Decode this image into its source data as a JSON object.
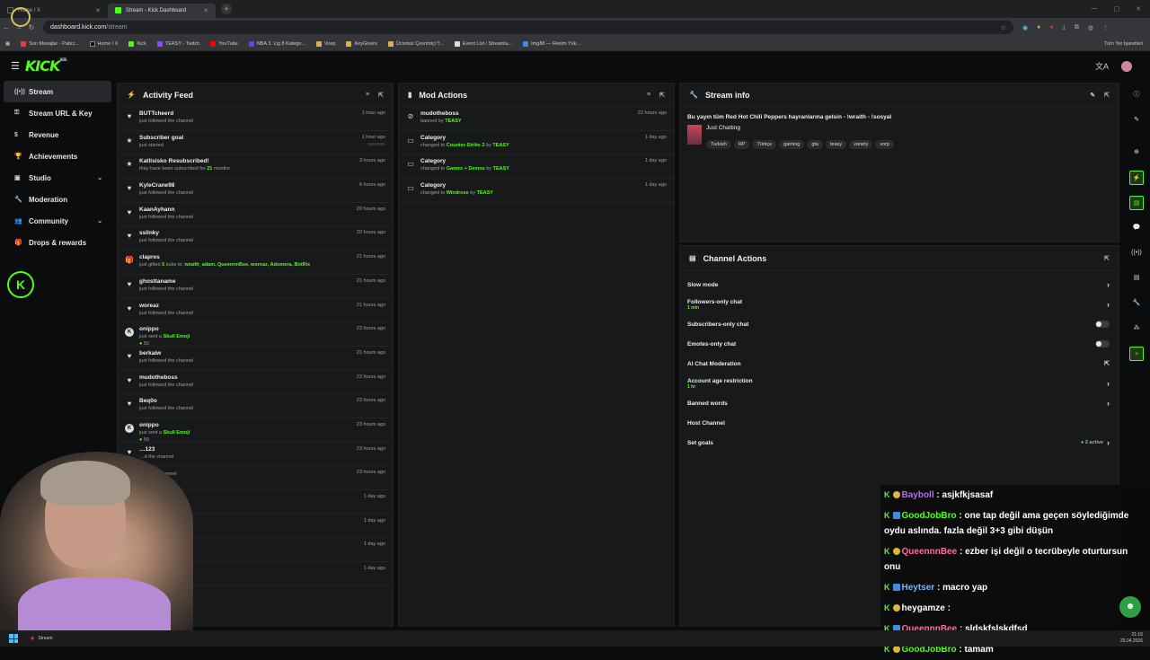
{
  "browser": {
    "tabs": [
      {
        "label": "Home / X",
        "active": false
      },
      {
        "label": "Stream - Kick Dashboard",
        "active": true
      }
    ],
    "url_host": "dashboard.kick.com",
    "url_path": "/stream",
    "bookmarks": [
      "Son Mesajlar - Pabci...",
      "Home / X",
      "Kick",
      "TEASY - Twitch",
      "YouTube",
      "NBA 3. Lig 8 Katego...",
      "Voep",
      "KeyGivers",
      "Ücretsiz Çevrimiçi Y...",
      "Event List / Streamla...",
      "Img88 — Resim Yük..."
    ],
    "bookmarks_right": "Tüm Yer İşaretleri"
  },
  "header": {
    "logo": "KICK",
    "logo_sup": "BETA"
  },
  "sidebar": {
    "items": [
      {
        "label": "Stream",
        "icon": "broadcast-icon",
        "active": true
      },
      {
        "label": "Stream URL & Key",
        "icon": "key-icon"
      },
      {
        "label": "Revenue",
        "icon": "dollar-icon"
      },
      {
        "label": "Achievements",
        "icon": "trophy-icon"
      },
      {
        "label": "Studio",
        "icon": "studio-icon",
        "expandable": true
      },
      {
        "label": "Moderation",
        "icon": "wrench-icon"
      },
      {
        "label": "Community",
        "icon": "people-icon",
        "expandable": true
      },
      {
        "label": "Drops & rewards",
        "icon": "gift-icon"
      }
    ]
  },
  "activity": {
    "title": "Activity Feed",
    "items": [
      {
        "name": "BUTTcheerd",
        "sub": "just followed the channel",
        "time": "1 hour ago",
        "icon": "heart"
      },
      {
        "name": "Subscriber goal",
        "sub": "just started",
        "time": "1 hour ago",
        "icon": "star"
      },
      {
        "name": "Katlisisko Resubscribed!",
        "sub": "they have been subscribed for ",
        "sub_green": "21",
        "sub_after": " months",
        "time": "3 hours ago",
        "icon": "star"
      },
      {
        "name": "KyleCrane98",
        "sub": "just followed the channel",
        "time": "6 hours ago",
        "icon": "heart"
      },
      {
        "name": "KaanAyhann",
        "sub": "just followed the channel",
        "time": "20 hours ago",
        "icon": "heart"
      },
      {
        "name": "sslinky",
        "sub": "just followed the channel",
        "time": "20 hours ago",
        "icon": "heart"
      },
      {
        "name": "clapres",
        "sub": "just gifted ",
        "sub_green": "5",
        "sub_after": " subs to: ",
        "sub_list": "wraith_adam, QueennnBee, woreaz, Adomera, BotRix",
        "time": "21 hours ago",
        "icon": "gift"
      },
      {
        "name": "ghosttaname",
        "sub": "just followed the channel",
        "time": "21 hours ago",
        "icon": "heart"
      },
      {
        "name": "woreaz",
        "sub": "just followed the channel",
        "time": "21 hours ago",
        "icon": "heart"
      },
      {
        "name": "onippo",
        "sub": "just sent a ",
        "sub_green": "Skull Emoji",
        "amount": "50",
        "time": "22 hours ago",
        "icon": "kick"
      },
      {
        "name": "berkaiw",
        "sub": "just followed the channel",
        "time": "21 hours ago",
        "icon": "heart"
      },
      {
        "name": "mudotheboss",
        "sub": "just followed the channel",
        "time": "22 hours ago",
        "icon": "heart"
      },
      {
        "name": "Beq0o",
        "sub": "just followed the channel",
        "time": "22 hours ago",
        "icon": "heart"
      },
      {
        "name": "onippo",
        "sub": "just sent a ",
        "sub_green": "Skull Emoji",
        "amount": "50",
        "time": "23 hours ago",
        "icon": "kick"
      },
      {
        "name": "…123",
        "sub": "…d the channel",
        "time": "23 hours ago",
        "icon": "heart"
      },
      {
        "name": "",
        "sub": "…ed the channel",
        "time": "23 hours ago",
        "icon": "heart"
      },
      {
        "name": "",
        "sub": "",
        "time": "1 day ago",
        "icon": "heart"
      },
      {
        "name": "",
        "sub": "",
        "time": "1 day ago",
        "icon": "heart"
      },
      {
        "name": "",
        "sub": "…oji",
        "time": "1 day ago",
        "icon": "kick"
      },
      {
        "name": "…06",
        "sub": "…he channel",
        "time": "1 day ago",
        "icon": "heart"
      }
    ]
  },
  "mod": {
    "title": "Mod Actions",
    "items": [
      {
        "name": "mudotheboss",
        "sub": "banned by ",
        "by": "TEASY",
        "time": "22 hours ago",
        "icon": "ban"
      },
      {
        "name": "Category",
        "sub": "changed to ",
        "cat": "Counter-Strike 2",
        "by": "TEASY",
        "time": "1 day ago",
        "icon": "cat"
      },
      {
        "name": "Category",
        "sub": "changed to ",
        "cat": "Games + Demos",
        "by": "TEASY",
        "time": "1 day ago",
        "icon": "cat"
      },
      {
        "name": "Category",
        "sub": "changed to ",
        "cat": "Windrose",
        "by": "TEASY",
        "time": "1 day ago",
        "icon": "cat"
      }
    ]
  },
  "stream_info": {
    "title": "Stream info",
    "stream_title": "Bu yayın tüm Red Hot Chili Peppers hayranlarına gelsin - !wraith - !sosyal",
    "category": "Just Chatting",
    "tags": [
      "Turkish",
      "RP",
      "Türkçe",
      "gaming",
      "gta",
      "teasy",
      "variety",
      "vorp"
    ]
  },
  "channel_actions": {
    "title": "Channel Actions",
    "rows": [
      {
        "label": "Slow mode",
        "control": "chevron"
      },
      {
        "label": "Followers-only chat",
        "sub": "1 min",
        "control": "chevron"
      },
      {
        "label": "Subscribers-only chat",
        "control": "toggle"
      },
      {
        "label": "Emotes-only chat",
        "control": "toggle"
      },
      {
        "label": "AI Chat Moderation",
        "control": "external"
      },
      {
        "label": "Account age restriction",
        "sub": "1 hr",
        "control": "chevron"
      },
      {
        "label": "Banned words",
        "control": "chevron"
      },
      {
        "label": "Host Channel",
        "control": "none"
      },
      {
        "label": "Set goals",
        "active": "2 active",
        "control": "chevron"
      }
    ]
  },
  "chat": [
    {
      "user": "Bayboll",
      "color": "#b46cf5",
      "text": "asjkfkjsasaf"
    },
    {
      "user": "GoodJobBro",
      "color": "#53fc18",
      "text": "one tap değil ama geçen söylediğimde oydu aslında. fazla değil 3+3 gibi düşün"
    },
    {
      "user": "QueennnBee",
      "color": "#ff6b9e",
      "text": "ezber işi değil o tecrübeyle oturtursun onu"
    },
    {
      "user": "Heytser",
      "color": "#7ab4ff",
      "text": "macro yap"
    },
    {
      "user": "heygamze",
      "color": "#ffffff",
      "text": ""
    },
    {
      "user": "QueennnBee",
      "color": "#ff6b9e",
      "text": "şldskfşlskdfsd"
    },
    {
      "user": "GoodJobBro",
      "color": "#53fc18",
      "text": "tamam"
    }
  ],
  "taskbar": {
    "app": "Stream",
    "time": "21:16",
    "date": "25.04.2026"
  },
  "colors": {
    "accent": "#53fc18",
    "panel": "#18191b",
    "bg": "#0b0c0e"
  }
}
